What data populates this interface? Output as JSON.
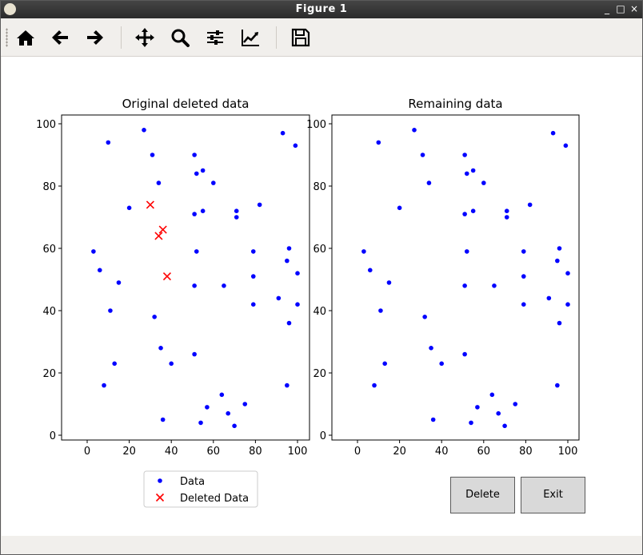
{
  "window": {
    "title": "Figure 1",
    "controls": [
      "_",
      "□",
      "×"
    ]
  },
  "toolbar": {
    "buttons": [
      {
        "name": "home-icon",
        "label": "Home"
      },
      {
        "name": "back-icon",
        "label": "Back"
      },
      {
        "name": "forward-icon",
        "label": "Forward"
      },
      {
        "name": "pan-icon",
        "label": "Pan"
      },
      {
        "name": "zoom-icon",
        "label": "Zoom"
      },
      {
        "name": "subplots-icon",
        "label": "Configure subplots"
      },
      {
        "name": "edit-axis-icon",
        "label": "Edit axis"
      },
      {
        "name": "save-icon",
        "label": "Save"
      }
    ]
  },
  "colors": {
    "data": "#0000ff",
    "deleted": "#ff0000",
    "button_bg": "#d9d9d9"
  },
  "chart_data": [
    {
      "type": "scatter",
      "title": "Original deleted data",
      "xlim": [
        0,
        100
      ],
      "ylim": [
        0,
        100
      ],
      "xticks": [
        0,
        20,
        40,
        60,
        80,
        100
      ],
      "yticks": [
        0,
        20,
        40,
        60,
        80,
        100
      ],
      "series": [
        {
          "name": "Data",
          "marker": "dot",
          "color": "#0000ff",
          "points": [
            [
              3,
              59
            ],
            [
              6,
              53
            ],
            [
              8,
              16
            ],
            [
              10,
              94
            ],
            [
              11,
              40
            ],
            [
              13,
              23
            ],
            [
              15,
              49
            ],
            [
              20,
              73
            ],
            [
              27,
              98
            ],
            [
              31,
              90
            ],
            [
              32,
              38
            ],
            [
              34,
              81
            ],
            [
              35,
              28
            ],
            [
              36,
              5
            ],
            [
              40,
              23
            ],
            [
              51,
              90
            ],
            [
              51,
              71
            ],
            [
              51,
              48
            ],
            [
              51,
              26
            ],
            [
              52,
              84
            ],
            [
              52,
              59
            ],
            [
              54,
              4
            ],
            [
              55,
              85
            ],
            [
              55,
              72
            ],
            [
              57,
              9
            ],
            [
              60,
              81
            ],
            [
              64,
              13
            ],
            [
              65,
              48
            ],
            [
              67,
              7
            ],
            [
              70,
              3
            ],
            [
              71,
              72
            ],
            [
              71,
              70
            ],
            [
              75,
              10
            ],
            [
              79,
              59
            ],
            [
              79,
              51
            ],
            [
              79,
              42
            ],
            [
              82,
              74
            ],
            [
              91,
              44
            ],
            [
              93,
              97
            ],
            [
              95,
              16
            ],
            [
              95,
              56
            ],
            [
              96,
              60
            ],
            [
              96,
              36
            ],
            [
              99,
              93
            ],
            [
              100,
              52
            ],
            [
              100,
              42
            ]
          ]
        },
        {
          "name": "Deleted Data",
          "marker": "x",
          "color": "#ff0000",
          "points": [
            [
              30,
              74
            ],
            [
              34,
              64
            ],
            [
              36,
              66
            ],
            [
              38,
              51
            ]
          ]
        }
      ],
      "legend": {
        "placement": "below",
        "entries": [
          "Data",
          "Deleted Data"
        ]
      }
    },
    {
      "type": "scatter",
      "title": "Remaining data",
      "xlim": [
        0,
        100
      ],
      "ylim": [
        0,
        100
      ],
      "xticks": [
        0,
        20,
        40,
        60,
        80,
        100
      ],
      "yticks": [
        0,
        20,
        40,
        60,
        80,
        100
      ],
      "series": [
        {
          "marker": "dot",
          "color": "#0000ff",
          "points": [
            [
              3,
              59
            ],
            [
              6,
              53
            ],
            [
              8,
              16
            ],
            [
              10,
              94
            ],
            [
              11,
              40
            ],
            [
              13,
              23
            ],
            [
              15,
              49
            ],
            [
              20,
              73
            ],
            [
              27,
              98
            ],
            [
              31,
              90
            ],
            [
              32,
              38
            ],
            [
              34,
              81
            ],
            [
              35,
              28
            ],
            [
              36,
              5
            ],
            [
              40,
              23
            ],
            [
              51,
              90
            ],
            [
              51,
              71
            ],
            [
              51,
              48
            ],
            [
              51,
              26
            ],
            [
              52,
              84
            ],
            [
              52,
              59
            ],
            [
              54,
              4
            ],
            [
              55,
              85
            ],
            [
              55,
              72
            ],
            [
              57,
              9
            ],
            [
              60,
              81
            ],
            [
              64,
              13
            ],
            [
              65,
              48
            ],
            [
              67,
              7
            ],
            [
              70,
              3
            ],
            [
              71,
              72
            ],
            [
              71,
              70
            ],
            [
              75,
              10
            ],
            [
              79,
              59
            ],
            [
              79,
              51
            ],
            [
              79,
              42
            ],
            [
              82,
              74
            ],
            [
              91,
              44
            ],
            [
              93,
              97
            ],
            [
              95,
              16
            ],
            [
              95,
              56
            ],
            [
              96,
              60
            ],
            [
              96,
              36
            ],
            [
              99,
              93
            ],
            [
              100,
              52
            ],
            [
              100,
              42
            ]
          ]
        }
      ]
    }
  ],
  "buttons": {
    "delete_label": "Delete",
    "exit_label": "Exit"
  }
}
